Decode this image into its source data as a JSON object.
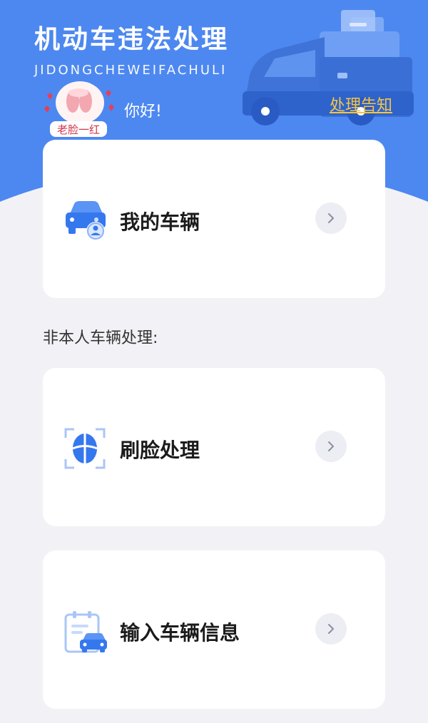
{
  "header": {
    "title": "机动车违法处理",
    "subtitle": "JIDONGCHEWEIFACHULI",
    "greeting": "你好!",
    "notice_link": "处理告知",
    "sticker_text": "老脸一红"
  },
  "cards": {
    "my_vehicle": {
      "label": "我的车辆",
      "icon": "car-user-icon"
    },
    "face": {
      "label": "刷脸处理",
      "icon": "face-scan-icon"
    },
    "input_vehicle": {
      "label": "输入车辆信息",
      "icon": "clipboard-car-icon"
    }
  },
  "section": {
    "non_owner_label": "非本人车辆处理:"
  },
  "colors": {
    "primary": "#4d88f0",
    "link": "#f5c542",
    "background": "#f2f2f6"
  }
}
